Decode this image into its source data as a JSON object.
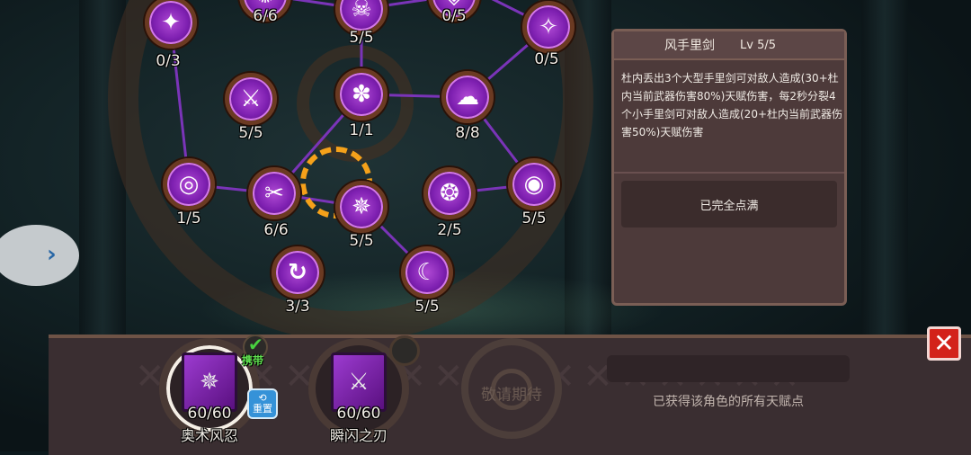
{
  "skill_tree": {
    "nodes": [
      {
        "id": "n1",
        "icon": "claw-icon",
        "glyph": "✦",
        "level": "0/3"
      },
      {
        "id": "n2",
        "icon": "rune-icon",
        "glyph": "✺",
        "level": "6/6"
      },
      {
        "id": "n3",
        "icon": "skull-icon",
        "glyph": "☠",
        "level": "5/5"
      },
      {
        "id": "n4",
        "icon": "rune-icon",
        "glyph": "◈",
        "level": "0/5"
      },
      {
        "id": "n5",
        "icon": "bat-icon",
        "glyph": "✧",
        "level": "0/5"
      },
      {
        "id": "n6",
        "icon": "crossed-swords-icon",
        "glyph": "⚔",
        "level": "5/5"
      },
      {
        "id": "n7",
        "icon": "swirl-icon",
        "glyph": "✽",
        "level": "1/1"
      },
      {
        "id": "n8",
        "icon": "cloud-icon",
        "glyph": "☁",
        "level": "8/8"
      },
      {
        "id": "n9",
        "icon": "target-icon",
        "glyph": "◎",
        "level": "1/5"
      },
      {
        "id": "n10",
        "icon": "blades-icon",
        "glyph": "✂",
        "level": "6/6"
      },
      {
        "id": "n11",
        "icon": "shuriken-icon",
        "glyph": "✵",
        "level": "5/5",
        "selected": true
      },
      {
        "id": "n12",
        "icon": "wind-icon",
        "glyph": "❂",
        "level": "2/5"
      },
      {
        "id": "n13",
        "icon": "eye-icon",
        "glyph": "◉",
        "level": "5/5"
      },
      {
        "id": "n14",
        "icon": "refresh-icon",
        "glyph": "↻",
        "level": "3/3"
      },
      {
        "id": "n15",
        "icon": "crescent-icon",
        "glyph": "☾",
        "level": "5/5"
      }
    ]
  },
  "detail_panel": {
    "title": "风手里剑",
    "level": "Lv 5/5",
    "description": "杜内丢出3个大型手里剑可对敌人造成(30+杜内当前武器伤害80%)天赋伤害，每2秒分裂4个小手里剑可对敌人造成(20+杜内当前武器伤害50%)天赋伤害",
    "status": "已完全点满"
  },
  "bottom": {
    "slots": [
      {
        "name": "奥术风忍",
        "count": "60/60",
        "icon": "shuriken-book-icon",
        "glyph": "✵",
        "active": true
      },
      {
        "name": "瞬闪之刃",
        "count": "60/60",
        "icon": "dagger-book-icon",
        "glyph": "🗡",
        "active": false
      }
    ],
    "carry_label": "携带",
    "reset_label": "重置",
    "coming_soon": "敬请期待",
    "all_obtained": "已获得该角色的所有天赋点"
  },
  "colors": {
    "node_fill": "#7d1fb0",
    "selection_ring": "#f5a11a",
    "panel_bg": "#4d3a3a",
    "close_button": "#d3221a",
    "carry_text": "#5fe04f",
    "reset_button": "#3592d8"
  }
}
